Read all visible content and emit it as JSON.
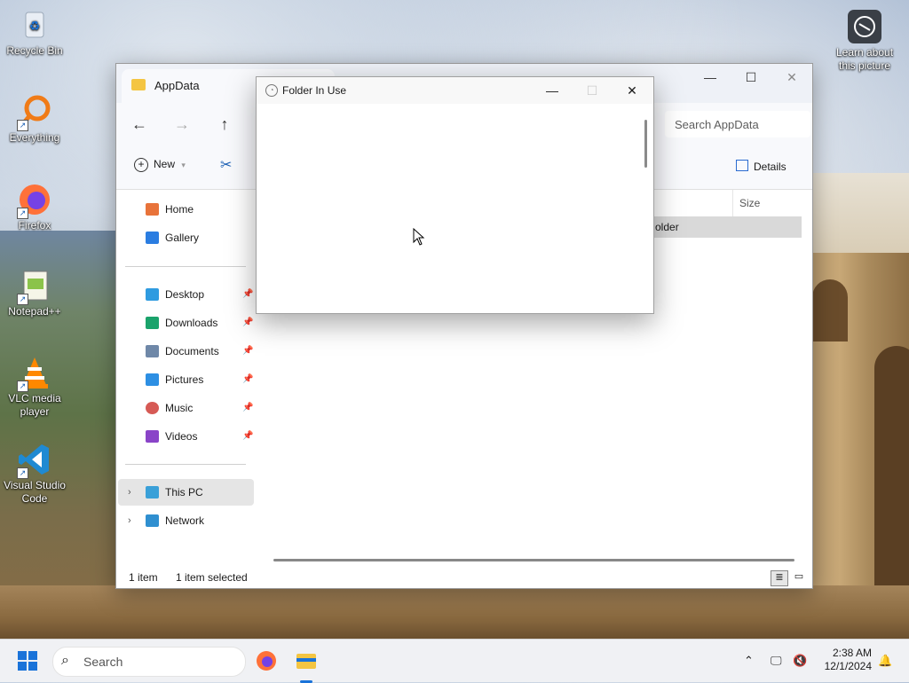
{
  "desktop": {
    "icons": [
      {
        "label": "Recycle Bin",
        "icon": "recycle-bin-icon"
      },
      {
        "label": "Everything",
        "icon": "everything-search-icon"
      },
      {
        "label": "Firefox",
        "icon": "firefox-icon"
      },
      {
        "label": "Notepad++",
        "icon": "notepad-plus-plus-icon"
      },
      {
        "label": "VLC media player",
        "icon": "vlc-icon"
      },
      {
        "label": "Visual Studio Code",
        "icon": "vscode-icon"
      }
    ],
    "spotlight_label": "Learn about this picture"
  },
  "explorer": {
    "tab_title": "AppData",
    "search_placeholder": "Search AppData",
    "new_label": "New",
    "details_label": "Details",
    "sidebar": {
      "top": [
        {
          "label": "Home",
          "icon": "home-icon"
        },
        {
          "label": "Gallery",
          "icon": "gallery-icon"
        }
      ],
      "pinned": [
        {
          "label": "Desktop",
          "icon": "desktop-folder-icon"
        },
        {
          "label": "Downloads",
          "icon": "downloads-icon"
        },
        {
          "label": "Documents",
          "icon": "documents-icon"
        },
        {
          "label": "Pictures",
          "icon": "pictures-icon"
        },
        {
          "label": "Music",
          "icon": "music-icon"
        },
        {
          "label": "Videos",
          "icon": "videos-icon"
        }
      ],
      "bottom": [
        {
          "label": "This PC",
          "icon": "this-pc-icon"
        },
        {
          "label": "Network",
          "icon": "network-icon"
        }
      ]
    },
    "columns": {
      "size": "Size"
    },
    "selected_row_text": "older",
    "status": {
      "count": "1 item",
      "selected": "1 item selected"
    }
  },
  "dialog": {
    "title": "Folder In Use"
  },
  "taskbar": {
    "search_placeholder": "Search",
    "time": "2:38 AM",
    "date": "12/1/2024"
  },
  "colors": {
    "accent": "#1a73d9",
    "folder": "#f4c542",
    "selected_bg": "#d9d9d9"
  }
}
